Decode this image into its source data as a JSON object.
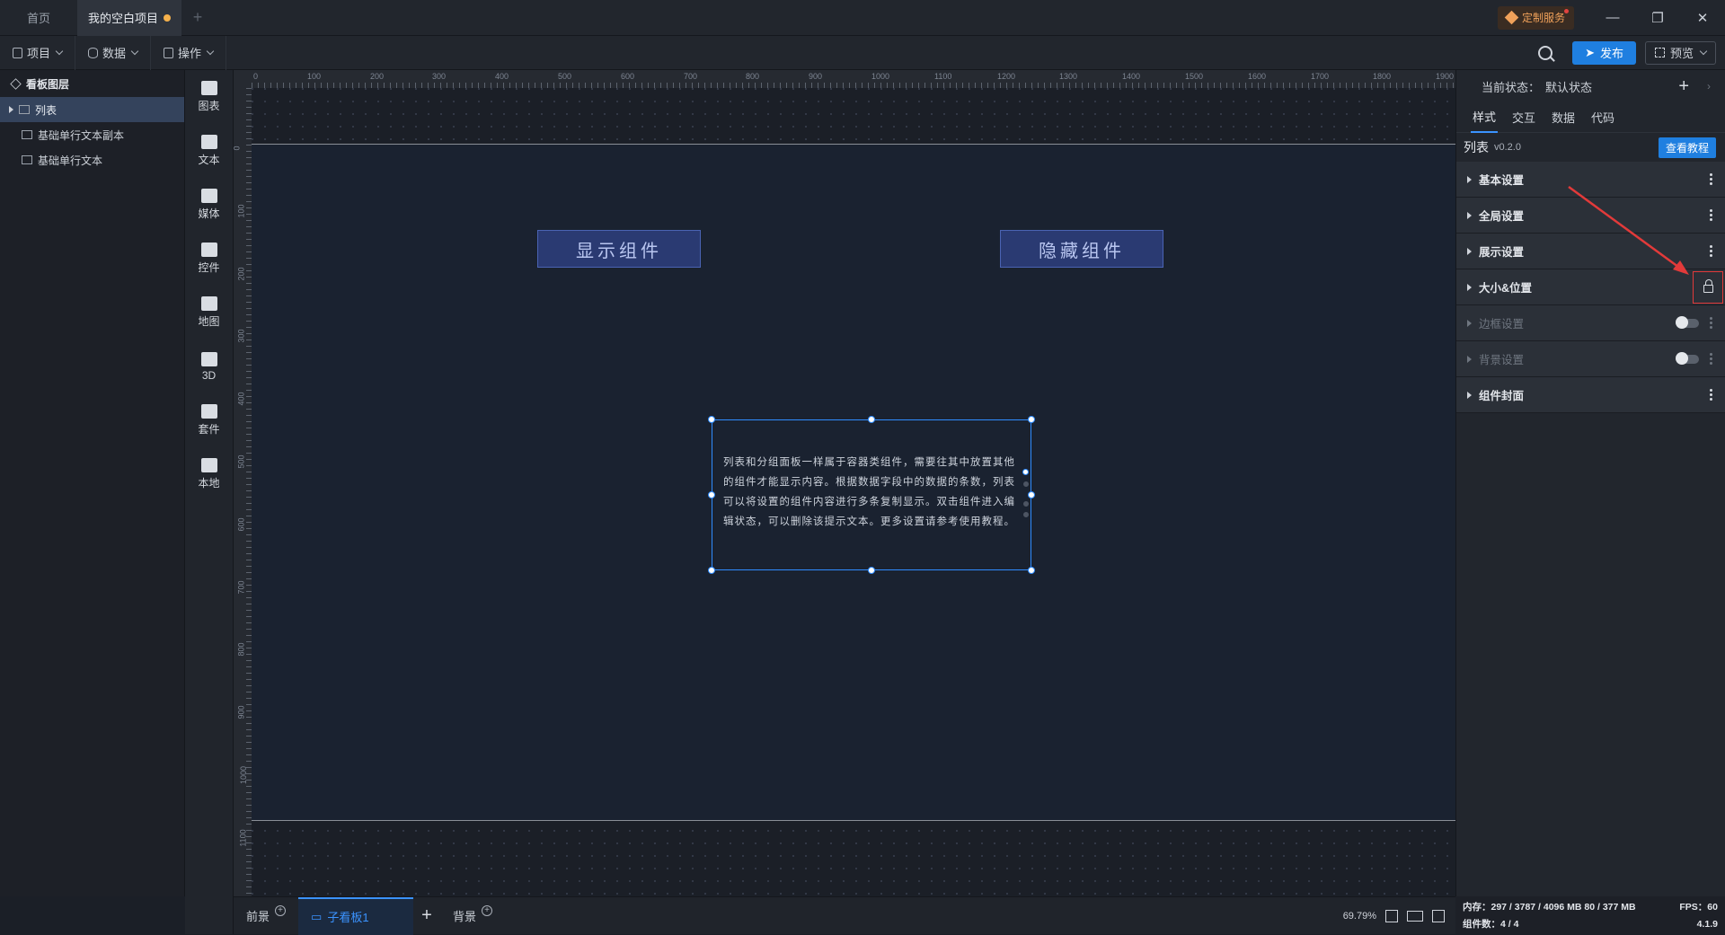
{
  "tabs": {
    "home": "首页",
    "project": "我的空白项目",
    "custom_service": "定制服务"
  },
  "menu": {
    "project": "项目",
    "data": "数据",
    "operate": "操作",
    "publish": "发布",
    "preview": "预览"
  },
  "layers": {
    "title": "看板图层",
    "items": [
      "列表",
      "基础单行文本副本",
      "基础单行文本"
    ]
  },
  "toolbox": [
    "图表",
    "文本",
    "媒体",
    "控件",
    "地图",
    "3D",
    "套件",
    "本地"
  ],
  "ruler": {
    "top": [
      "0",
      "100",
      "200",
      "300",
      "400",
      "500",
      "600",
      "700",
      "800",
      "900",
      "1000",
      "1100",
      "1200",
      "1300",
      "1400",
      "1500",
      "1600",
      "1700",
      "1800",
      "1900"
    ],
    "left": [
      "0",
      "100",
      "200",
      "300",
      "400",
      "500",
      "600",
      "700",
      "800",
      "900",
      "1000",
      "1100"
    ]
  },
  "canvas": {
    "show_button": "显示组件",
    "hide_button": "隐藏组件",
    "list_text": "列表和分组面板一样属于容器类组件，需要往其中放置其他的组件才能显示内容。根据数据字段中的数据的条数，列表可以将设置的组件内容进行多条复制显示。双击组件进入编辑状态，可以删除该提示文本。更多设置请参考使用教程。"
  },
  "boards": {
    "front": "前景",
    "sub": "子看板1",
    "back": "背景",
    "zoom": "69.79%"
  },
  "props": {
    "state_label": "当前状态：",
    "state_value": "默认状态",
    "tabs": [
      "样式",
      "交互",
      "数据",
      "代码"
    ],
    "component_name": "列表",
    "component_version": "v0.2.0",
    "tutorial": "查看教程",
    "sections": [
      "基本设置",
      "全局设置",
      "展示设置",
      "大小&位置",
      "边框设置",
      "背景设置",
      "组件封面"
    ]
  },
  "status": {
    "memory": "内存：297 / 3787 / 4096 MB 80 / 377 MB",
    "fps": "FPS：60",
    "count": "组件数：4 / 4",
    "version": "4.1.9"
  },
  "colors": {
    "accent": "#1f7fe0",
    "selection": "#2f8cff",
    "highlight": "#e23a3a",
    "button_fill": "#2a3a72"
  }
}
